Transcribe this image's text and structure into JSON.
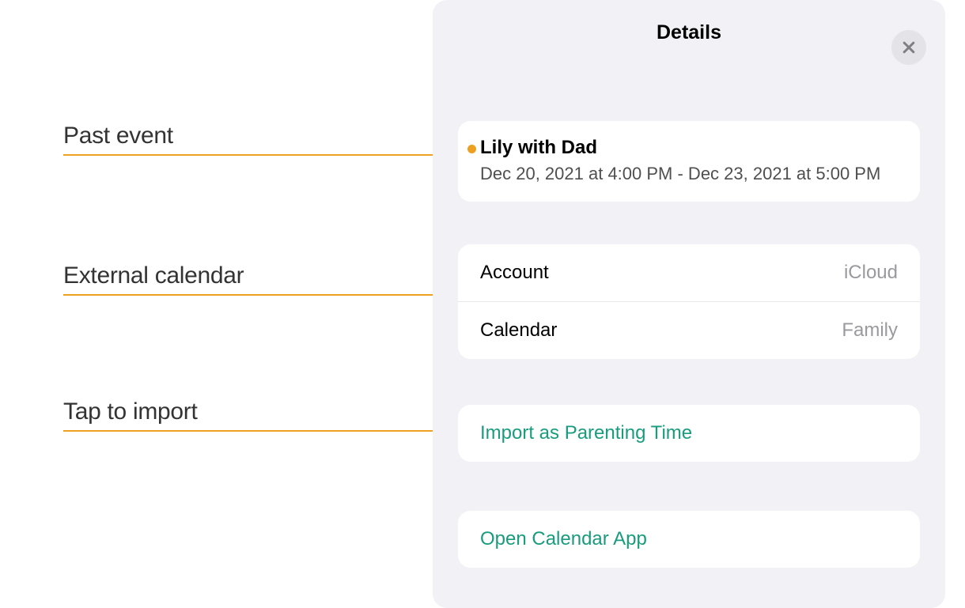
{
  "annotations": {
    "past_event": "Past event",
    "external_calendar": "External calendar",
    "tap_to_import": "Tap to import"
  },
  "panel": {
    "title": "Details"
  },
  "event": {
    "title": "Lily with Dad",
    "time_range": "Dec 20, 2021 at 4:00 PM - Dec 23, 2021 at 5:00 PM"
  },
  "info": {
    "account_label": "Account",
    "account_value": "iCloud",
    "calendar_label": "Calendar",
    "calendar_value": "Family"
  },
  "actions": {
    "import": "Import as Parenting Time",
    "open_app": "Open Calendar App"
  },
  "colors": {
    "accent_orange": "#EEA120",
    "accent_teal": "#189C7D",
    "panel_bg": "#F2F1F6",
    "close_bg": "#E4E3E8",
    "muted_text": "#9A9A9E"
  }
}
